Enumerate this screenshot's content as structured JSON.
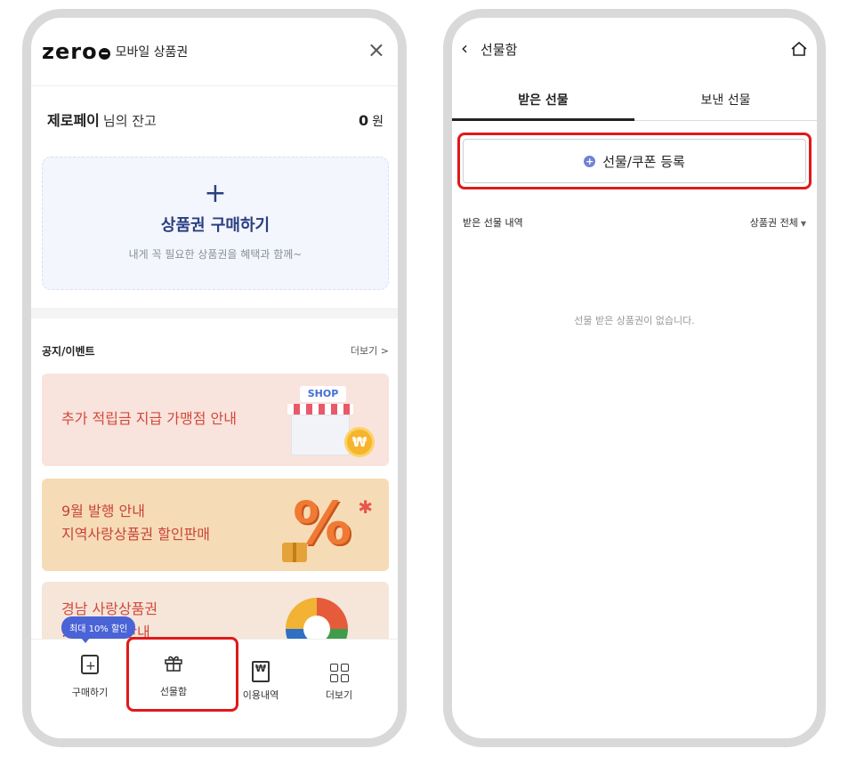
{
  "left": {
    "logo": "zero",
    "app_name": "모바일 상품권",
    "close_icon": "×",
    "balance": {
      "name": "제로페이",
      "suffix": "님의 잔고",
      "amount": "0",
      "unit": "원"
    },
    "buy_card": {
      "plus": "+",
      "title": "상품권 구매하기",
      "subtitle": "내게 꼭 필요한 상품권을 혜택과 함께~"
    },
    "notice": {
      "title": "공지/이벤트",
      "more": "더보기 >"
    },
    "banners": [
      {
        "lines": [
          "추가 적립금 지급 가맹점 안내"
        ],
        "illustration": "SHOP",
        "coin": "₩"
      },
      {
        "lines": [
          "9월 발행 안내",
          "지역사랑상품권 할인판매"
        ],
        "illustration": "%"
      },
      {
        "lines": [
          "경남 사랑상품권",
          "…구 전체 안내"
        ]
      }
    ],
    "tooltip": "최대 10% 할인",
    "nav": [
      {
        "label": "구매하기",
        "icon": "buy-icon"
      },
      {
        "label": "선물함",
        "icon": "gift-icon",
        "glyph": "🎁︎"
      },
      {
        "label": "이용내역",
        "icon": "receipt-icon",
        "glyph": "₩"
      },
      {
        "label": "더보기",
        "icon": "grid-icon"
      }
    ],
    "highlight_color": "#e0191b"
  },
  "right": {
    "title": "선물함",
    "back_icon": "‹",
    "tabs": [
      {
        "label": "받은 선물",
        "active": true
      },
      {
        "label": "보낸 선물",
        "active": false
      }
    ],
    "register_button": {
      "icon": "+",
      "label": "선물/쿠폰 등록"
    },
    "list_title": "받은 선물 내역",
    "filter": {
      "label": "상품권 전체",
      "arrow": "▼"
    },
    "empty_message": "선물 받은 상품권이 없습니다.",
    "highlight_color": "#e0191b"
  }
}
